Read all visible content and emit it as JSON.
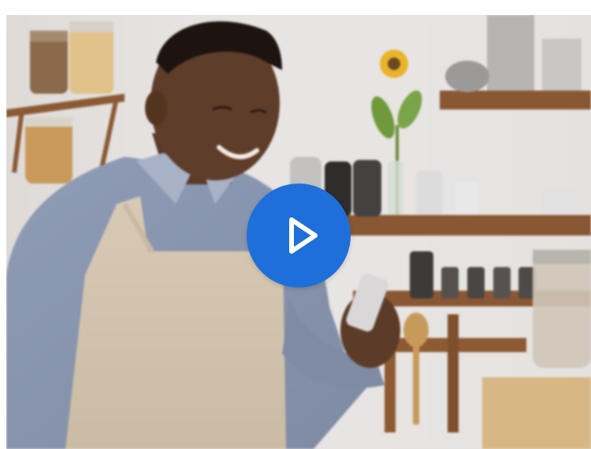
{
  "video": {
    "play_label": "",
    "icon": "play-icon",
    "accent_color": "#1e6fd9"
  }
}
